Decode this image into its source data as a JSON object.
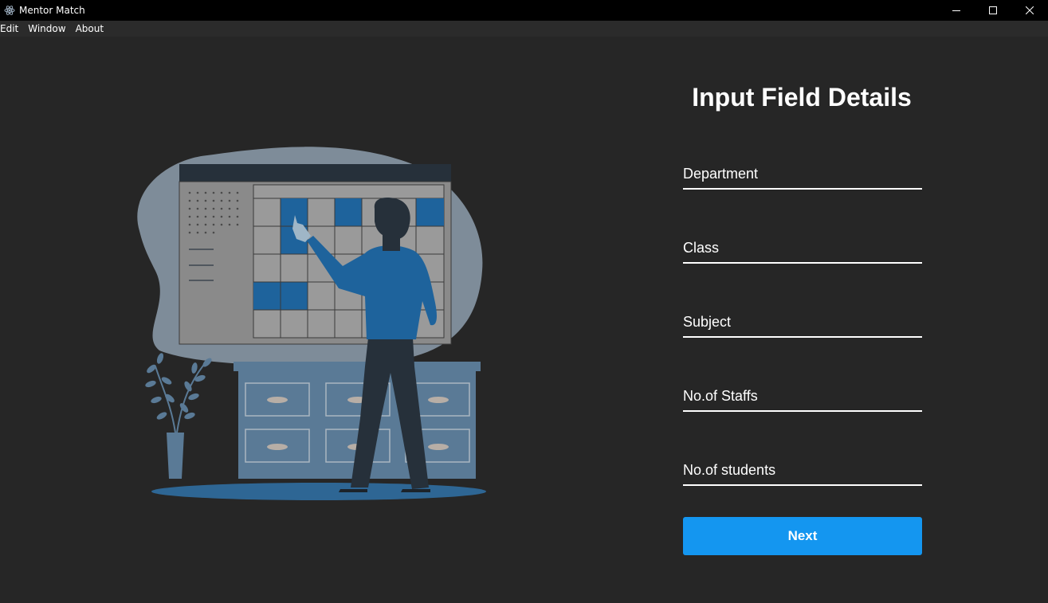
{
  "window": {
    "title": "Mentor Match"
  },
  "menu": {
    "items": [
      "Edit",
      "Window",
      "About"
    ]
  },
  "form": {
    "title": "Input Field Details",
    "fields": [
      {
        "placeholder": "Department",
        "value": ""
      },
      {
        "placeholder": "Class",
        "value": ""
      },
      {
        "placeholder": "Subject",
        "value": ""
      },
      {
        "placeholder": "No.of Staffs",
        "value": ""
      },
      {
        "placeholder": "No.of students",
        "value": ""
      }
    ],
    "next_label": "Next"
  },
  "colors": {
    "background": "#262626",
    "accent": "#1496f0",
    "illustration_blue": "#1e639c",
    "illustration_blob": "#7e8c99"
  },
  "icons": {
    "app": "electron-atom-icon",
    "minimize": "minimize-icon",
    "maximize": "maximize-icon",
    "close": "close-icon"
  }
}
